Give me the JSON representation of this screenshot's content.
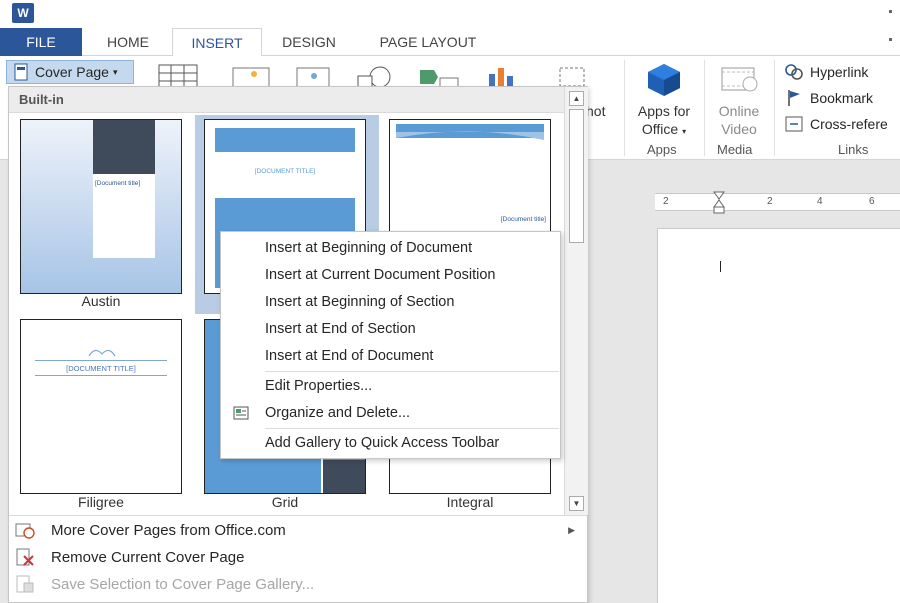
{
  "titlebar": {
    "app_icon_letter": "W"
  },
  "tabs": [
    {
      "label": "FILE"
    },
    {
      "label": "HOME"
    },
    {
      "label": "INSERT"
    },
    {
      "label": "DESIGN"
    },
    {
      "label": "PAGE LAYOUT"
    }
  ],
  "ribbon": {
    "cover_page_label": "Cover Page",
    "screenshot_partial": "hot",
    "apps_for_office": [
      "Apps for",
      "Office"
    ],
    "online_video": [
      "Online",
      "Video"
    ],
    "links": {
      "hyperlink": "Hyperlink",
      "bookmark": "Bookmark",
      "cross_reference": "Cross-refere"
    },
    "group_labels": {
      "apps": "Apps",
      "media": "Media",
      "links": "Links"
    }
  },
  "ruler": {
    "ticks": [
      "2",
      "2",
      "4",
      "6"
    ]
  },
  "gallery": {
    "header": "Built-in",
    "thumbnails": [
      {
        "name": "Austin",
        "title": "[Document title]"
      },
      {
        "name": "",
        "title": "[DOCUMENT TITLE]"
      },
      {
        "name": "",
        "title": "[Document title]"
      },
      {
        "name": "Filigree",
        "title": "[DOCUMENT TITLE]"
      },
      {
        "name": "Grid",
        "title": ""
      },
      {
        "name": "Integral",
        "title": ""
      }
    ]
  },
  "context_menu": {
    "items": [
      "Insert at Beginning of Document",
      "Insert at Current Document Position",
      "Insert at Beginning of Section",
      "Insert at End of Section",
      "Insert at End of Document",
      "Edit Properties...",
      "Organize and Delete...",
      "Add Gallery to Quick Access Toolbar"
    ]
  },
  "footer": {
    "more": "More Cover Pages from Office.com",
    "remove": "Remove Current Cover Page",
    "save": "Save Selection to Cover Page Gallery..."
  },
  "colors": {
    "accent": "#2b579a",
    "selection": "#b8cce4",
    "thumb_blue": "#5b9bd5"
  }
}
